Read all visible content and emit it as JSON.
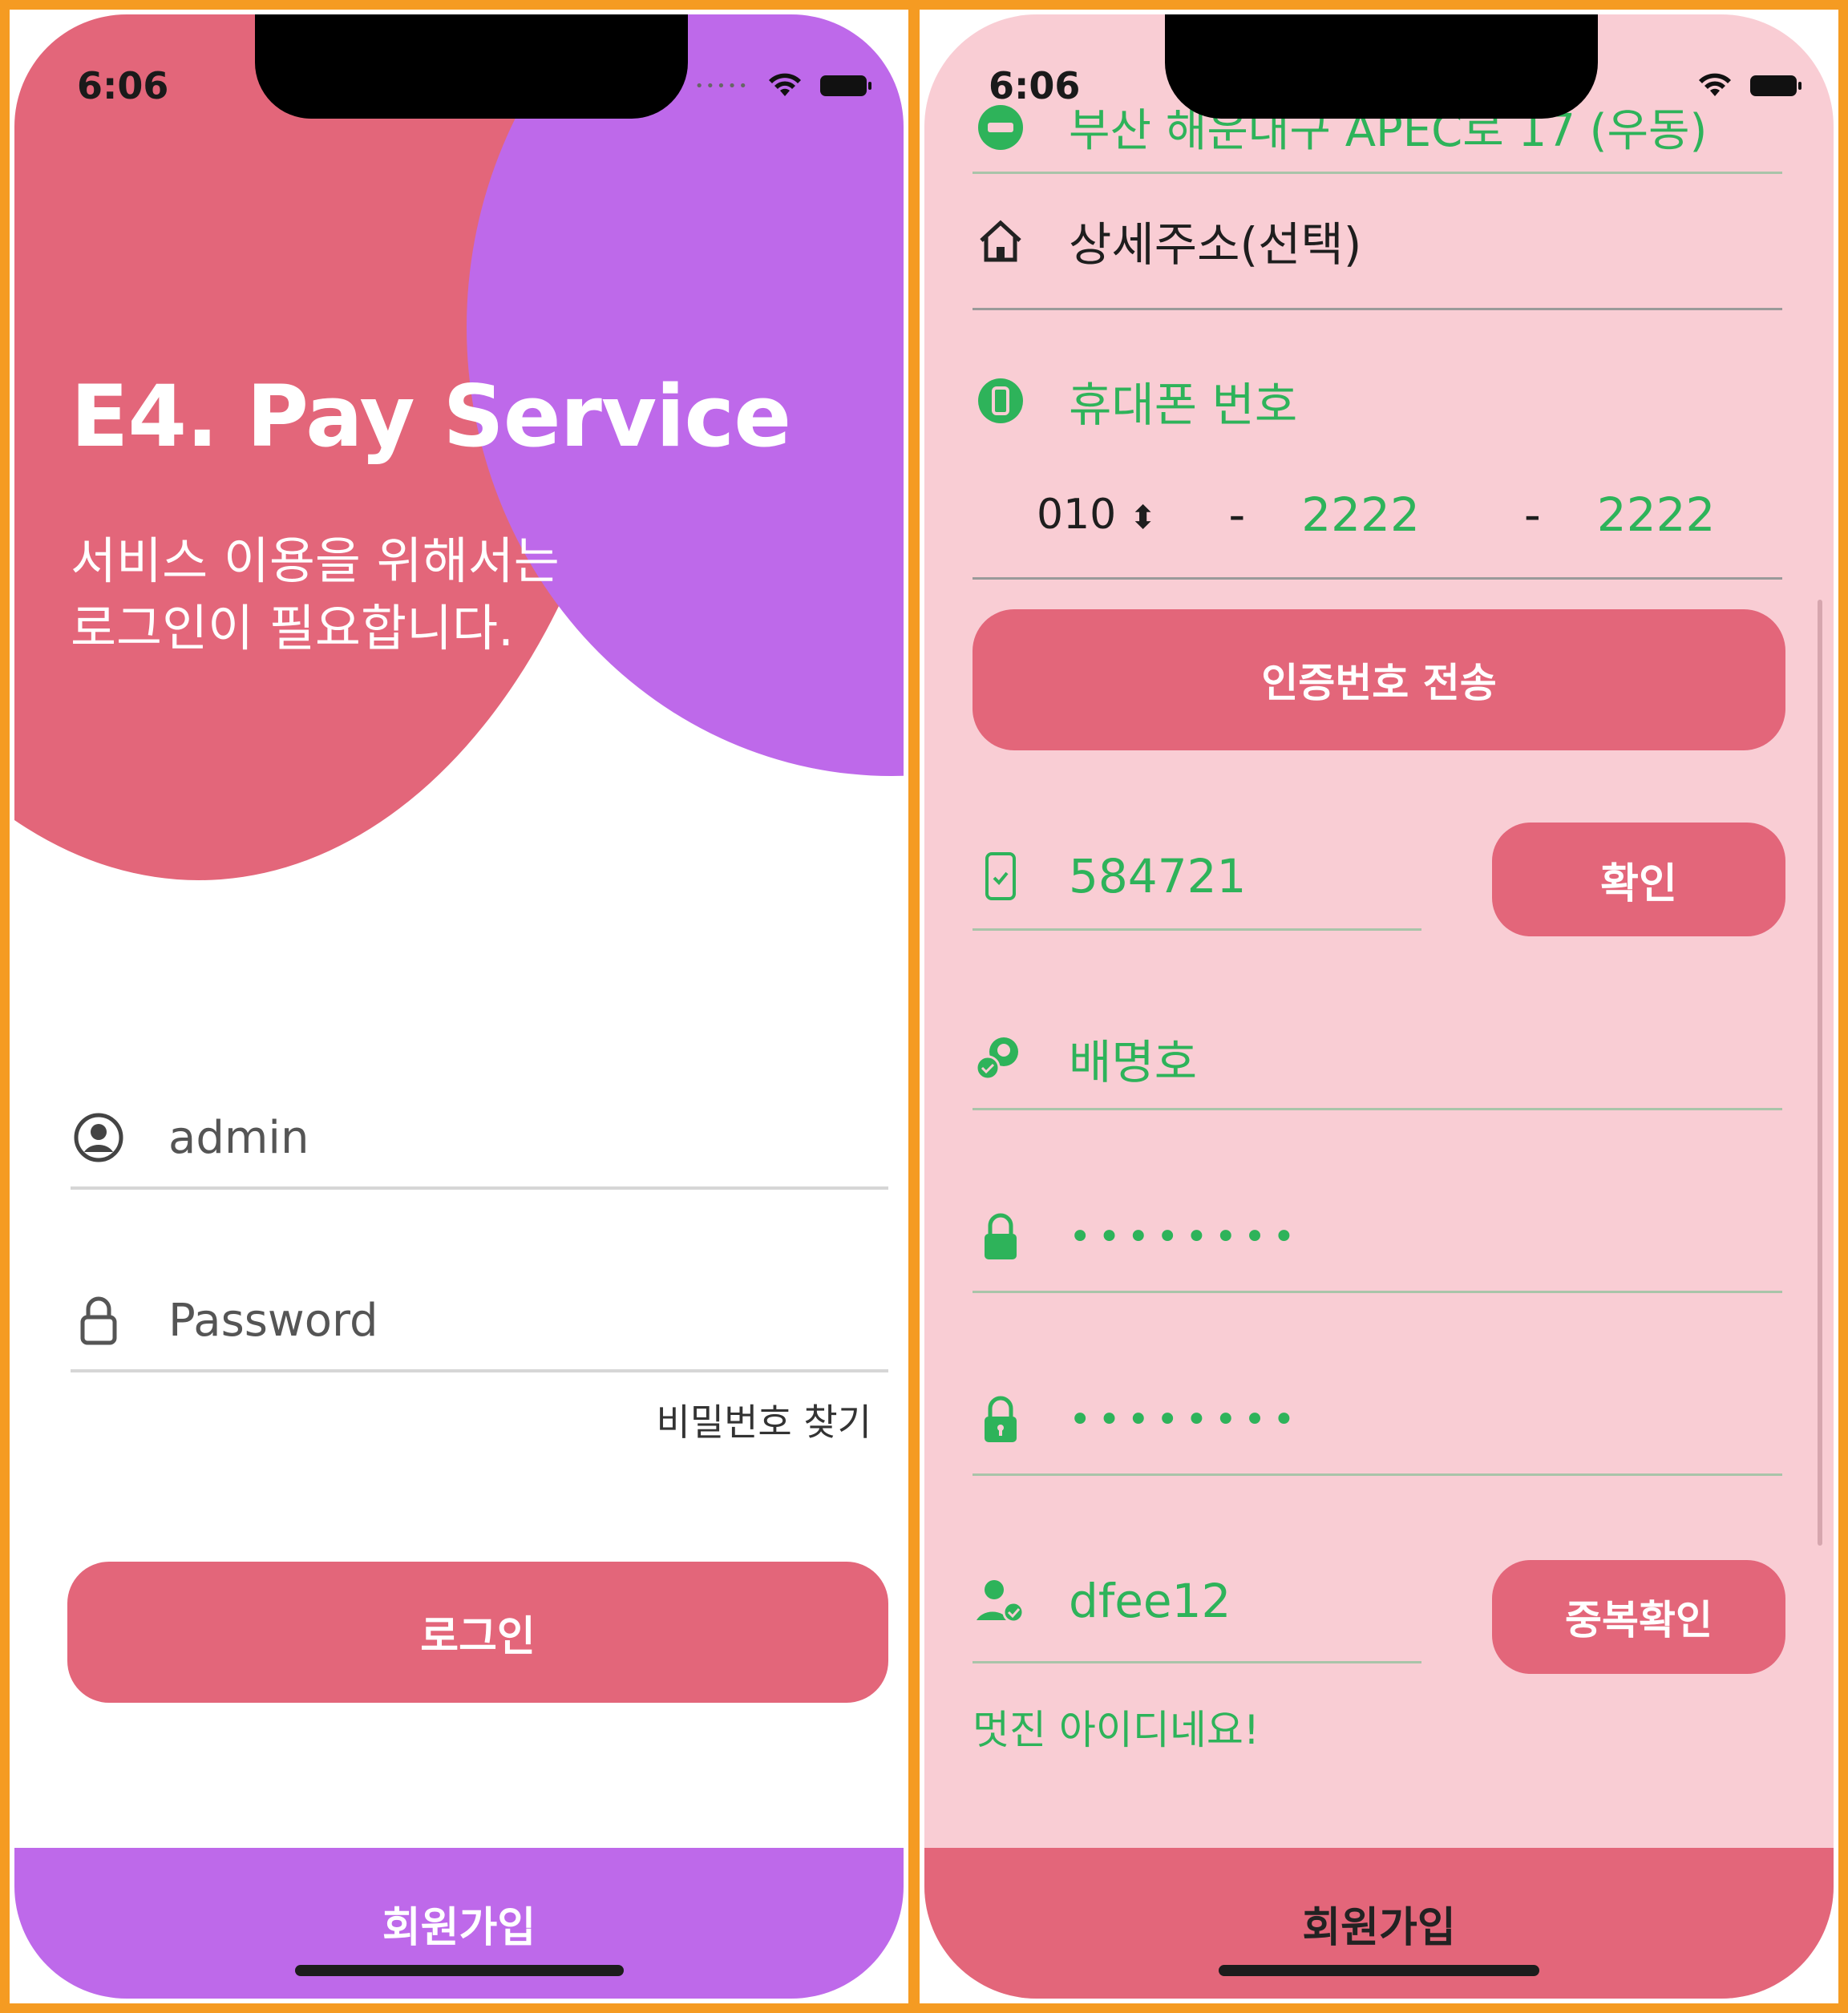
{
  "status": {
    "time": "6:06"
  },
  "login": {
    "title": "E4. Pay Service",
    "subtitle_line1": "서비스 이용을 위해서는",
    "subtitle_line2": "로그인이 필요합니다.",
    "username_value": "admin",
    "password_placeholder": "Password",
    "forgot_label": "비밀번호 찾기",
    "login_label": "로그인",
    "signup_label": "회원가입"
  },
  "signup": {
    "address_value": "부산 해운대구 APEC로 17 (우동)",
    "detail_placeholder": "상세주소(선택)",
    "phone_label": "휴대폰 번호",
    "phone_prefix": "010",
    "phone_dash": "-",
    "phone_mid": "2222",
    "phone_last": "2222",
    "send_code_label": "인증번호 전송",
    "code_value": "584721",
    "confirm_label": "확인",
    "name_value": "배명호",
    "password_mask": "••••••••",
    "password_confirm_mask": "••••••••",
    "userid_value": "dfee12",
    "dup_check_label": "중복확인",
    "id_message": "멋진 아이디네요!",
    "signup_label": "회원가입"
  },
  "colors": {
    "accent": "#E3667A",
    "purple": "#BE69EA",
    "green": "#2EB35A",
    "frame": "#F59B22",
    "pink_bg": "#F9CDD4"
  }
}
